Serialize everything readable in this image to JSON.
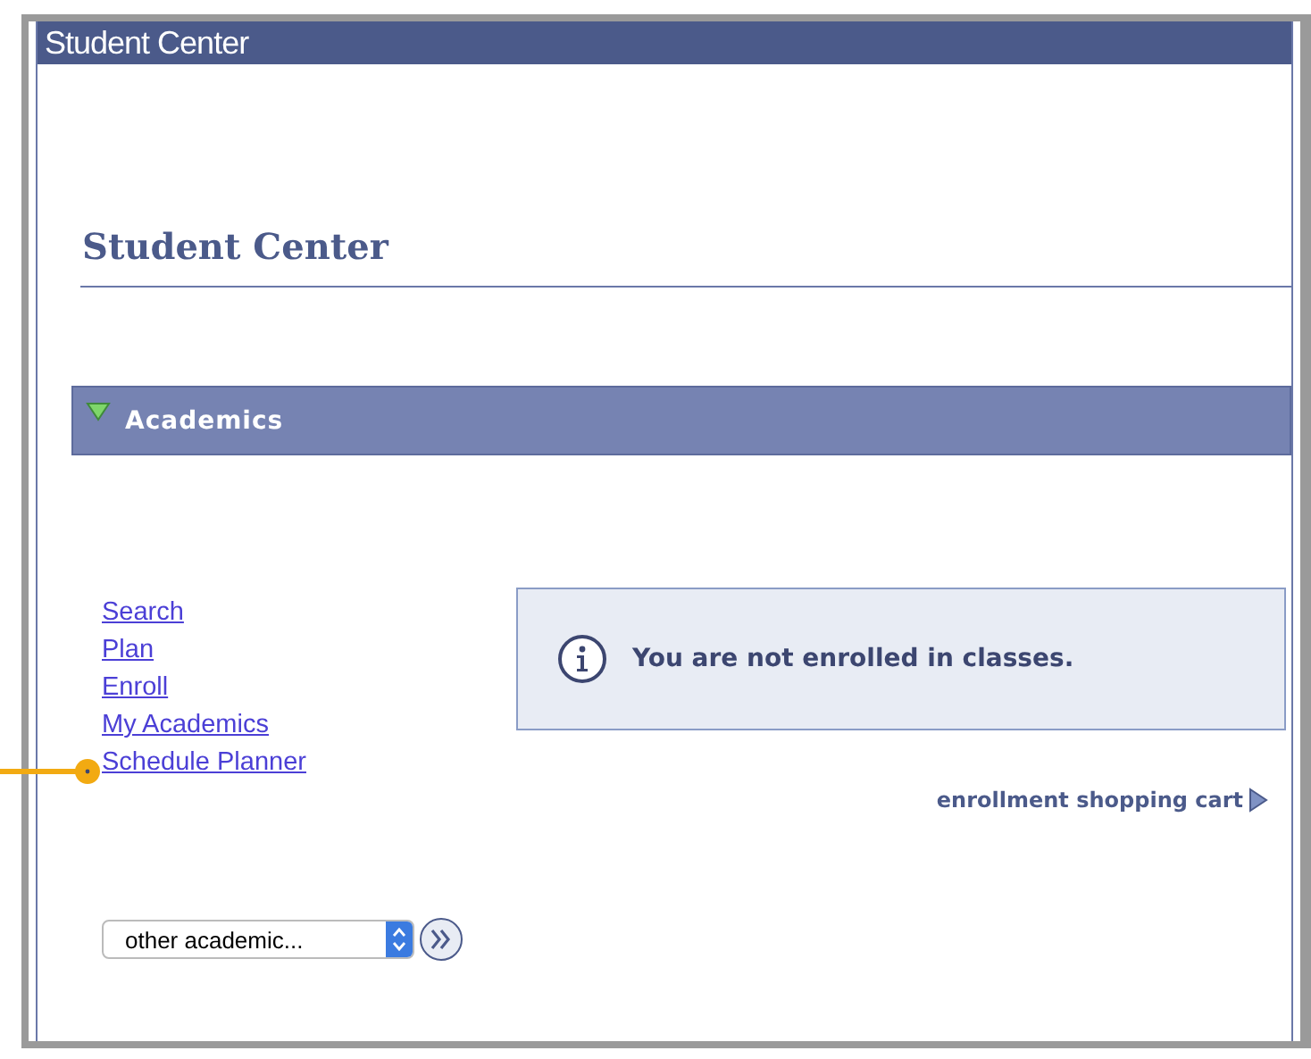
{
  "window": {
    "title": "Student Center"
  },
  "page_title": "Student Center",
  "section": {
    "title": "Academics",
    "expanded": true
  },
  "links": [
    {
      "label": "Search"
    },
    {
      "label": "Plan"
    },
    {
      "label": "Enroll"
    },
    {
      "label": "My Academics"
    },
    {
      "label": "Schedule Planner",
      "callout": true
    }
  ],
  "message": "You are not enrolled in classes.",
  "cart_link": "enrollment shopping cart",
  "dropdown": {
    "value": "other academic..."
  }
}
